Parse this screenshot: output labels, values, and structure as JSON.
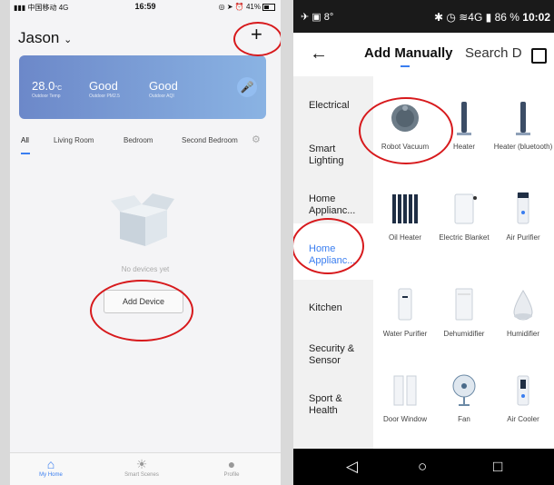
{
  "left_phone": {
    "status": {
      "carrier": "中国移动",
      "network": "4G",
      "time": "16:59",
      "battery": "41%"
    },
    "user_name": "Jason",
    "add_icon": "plus-icon",
    "weather": [
      {
        "value": "28.0",
        "unit": "°C",
        "label": "Outdoor Temp"
      },
      {
        "value": "Good",
        "unit": "",
        "label": "Outdoor PM2.5"
      },
      {
        "value": "Good",
        "unit": "",
        "label": "Outdoor AQI"
      }
    ],
    "rooms": [
      "All",
      "Living Room",
      "Bedroom",
      "Second Bedroom"
    ],
    "empty_text": "No devices yet",
    "add_device_label": "Add Device",
    "tabs": [
      {
        "label": "My Home",
        "icon": "home-icon"
      },
      {
        "label": "Smart Scenes",
        "icon": "sun-icon"
      },
      {
        "label": "Profile",
        "icon": "profile-icon"
      }
    ]
  },
  "right_phone": {
    "status": {
      "signal_text": "8°",
      "network": "4G",
      "battery": "86 %",
      "time": "10:02"
    },
    "tabs": {
      "active": "Add Manually",
      "other": "Search D"
    },
    "categories": [
      "Electrical",
      "Smart Lighting",
      "Home Applianc...",
      "Home Applianc...",
      "Kitchen",
      "Security & Sensor",
      "Sport & Health"
    ],
    "devices": [
      {
        "label": "Robot Vacuum",
        "icon": "robot-vacuum-icon"
      },
      {
        "label": "Heater",
        "icon": "heater-icon"
      },
      {
        "label": "Heater (bluetooth)",
        "icon": "heater-icon"
      },
      {
        "label": "Oil Heater",
        "icon": "oil-heater-icon"
      },
      {
        "label": "Electric Blanket",
        "icon": "blanket-icon"
      },
      {
        "label": "Air Purifier",
        "icon": "air-purifier-icon"
      },
      {
        "label": "Water Purifier",
        "icon": "water-purifier-icon"
      },
      {
        "label": "Dehumidifier",
        "icon": "dehumidifier-icon"
      },
      {
        "label": "Humidifier",
        "icon": "humidifier-icon"
      },
      {
        "label": "Door Window",
        "icon": "door-window-icon"
      },
      {
        "label": "Fan",
        "icon": "fan-icon"
      },
      {
        "label": "Air Cooler",
        "icon": "air-cooler-icon"
      }
    ]
  },
  "colors": {
    "accent": "#3a7ef0",
    "annotation": "#d7191c",
    "weather_start": "#6c88c9",
    "weather_end": "#8ab3e3"
  }
}
